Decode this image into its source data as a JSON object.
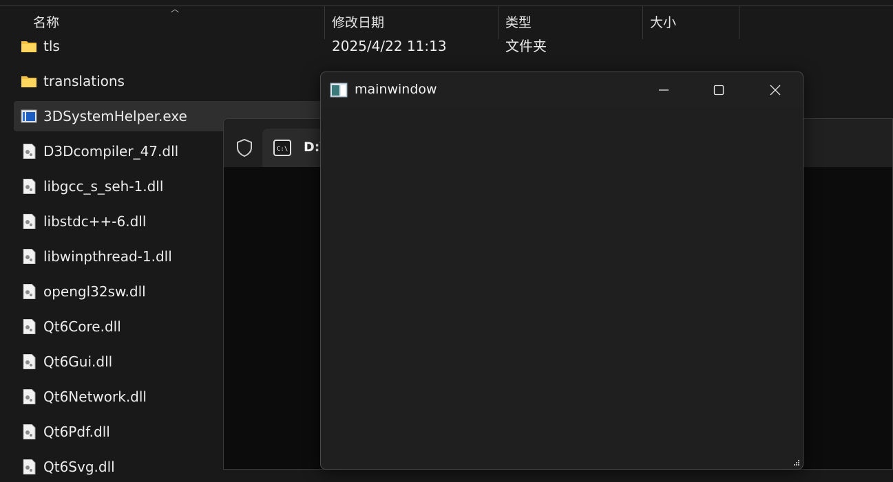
{
  "explorer": {
    "columns": {
      "name": "名称",
      "modified": "修改日期",
      "type": "类型",
      "size": "大小"
    },
    "rows": [
      {
        "name": "tls",
        "date": "2025/4/22 11:13",
        "type": "文件夹",
        "icon": "folder-icon"
      },
      {
        "name": "translations",
        "date": "",
        "type": "",
        "icon": "folder-icon"
      },
      {
        "name": "3DSystemHelper.exe",
        "date": "",
        "type": "",
        "icon": "exe-icon",
        "selected": true
      },
      {
        "name": "D3Dcompiler_47.dll",
        "icon": "dll-icon"
      },
      {
        "name": "libgcc_s_seh-1.dll",
        "icon": "dll-icon"
      },
      {
        "name": "libstdc++-6.dll",
        "icon": "dll-icon"
      },
      {
        "name": "libwinpthread-1.dll",
        "icon": "dll-icon"
      },
      {
        "name": "opengl32sw.dll",
        "icon": "dll-icon"
      },
      {
        "name": "Qt6Core.dll",
        "icon": "dll-icon"
      },
      {
        "name": "Qt6Gui.dll",
        "icon": "dll-icon"
      },
      {
        "name": "Qt6Network.dll",
        "icon": "dll-icon"
      },
      {
        "name": "Qt6Pdf.dll",
        "icon": "dll-icon"
      },
      {
        "name": "Qt6Svg.dll",
        "icon": "dll-icon"
      }
    ]
  },
  "terminal": {
    "tab_title": "D:\\"
  },
  "mainwindow": {
    "title": "mainwindow",
    "icon": "app-window-icon"
  }
}
